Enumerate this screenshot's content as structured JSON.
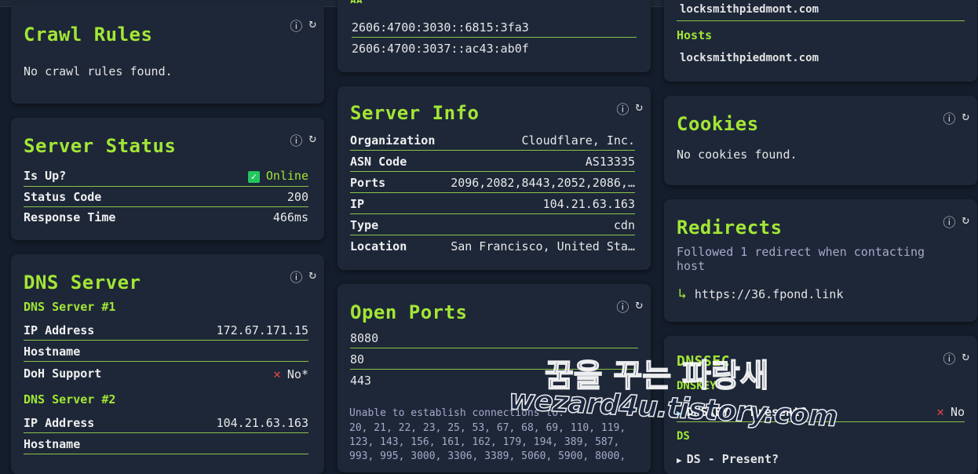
{
  "icons": {
    "info": "ⓘ",
    "refresh": "↻",
    "check": "✓",
    "cross": "✕",
    "redirect_arrow": "↳",
    "dnssec_play": "▶"
  },
  "crawl_rules": {
    "title": "Crawl Rules",
    "message": "No crawl rules found."
  },
  "server_status": {
    "title": "Server Status",
    "rows": [
      {
        "key": "Is Up?",
        "value": "Online"
      },
      {
        "key": "Status Code",
        "value": "200"
      },
      {
        "key": "Response Time",
        "value": "466ms"
      }
    ]
  },
  "dns_server": {
    "title": "DNS Server",
    "servers": [
      {
        "heading": "DNS Server #1",
        "ip_label": "IP Address",
        "ip": "172.67.171.15",
        "host_label": "Hostname",
        "doh_label": "DoH Support",
        "doh": "No*"
      },
      {
        "heading": "DNS Server #2",
        "ip_label": "IP Address",
        "ip": "104.21.63.163",
        "host_label": "Hostname"
      }
    ]
  },
  "dns_records_partial": {
    "label": "AA",
    "rows": [
      "2606:4700:3030::6815:3fa3",
      "2606:4700:3037::ac43:ab0f"
    ]
  },
  "server_info": {
    "title": "Server Info",
    "rows": [
      {
        "key": "Organization",
        "value": "Cloudflare, Inc."
      },
      {
        "key": "ASN Code",
        "value": "AS13335"
      },
      {
        "key": "Ports",
        "value": "2096,2082,8443,2052,2086,…"
      },
      {
        "key": "IP",
        "value": "104.21.63.163"
      },
      {
        "key": "Type",
        "value": "cdn"
      },
      {
        "key": "Location",
        "value": "San Francisco, United Sta…"
      }
    ]
  },
  "open_ports": {
    "title": "Open Ports",
    "ports": [
      "8080",
      "80",
      "443"
    ],
    "note": "Unable to establish connections to:",
    "closed_lines": [
      "20, 21, 22, 23, 25, 53, 67, 68, 69, 110, 119,",
      "123, 143, 156, 161, 162, 179, 194, 389, 587,",
      "993, 995, 3000, 3306, 3389, 5060, 5900, 8000,"
    ]
  },
  "hosts_partial": {
    "top_host": "locksmithpiedmont.com",
    "hosts_label": "Hosts",
    "host": "locksmithpiedmont.com"
  },
  "cookies": {
    "title": "Cookies",
    "message": "No cookies found."
  },
  "redirects": {
    "title": "Redirects",
    "message": "Followed 1 redirect when contacting host",
    "url": "https://36.fpond.link"
  },
  "dnssec": {
    "title": "DNSSEC",
    "dnskey_label": "DNSKEY",
    "present_label": "DNSKEY - Present?",
    "present_value": "No",
    "ds_label": "DS",
    "ds_row_label": "DS - Present?"
  },
  "watermark": {
    "line1": "꿈을 꾸는 파랑새",
    "line2": "wezard4u.tistory.com"
  }
}
